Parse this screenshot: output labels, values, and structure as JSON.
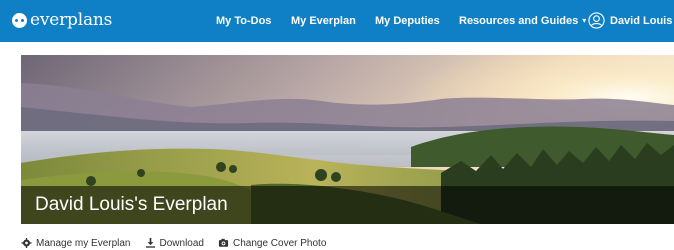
{
  "brand": {
    "name": "everplans",
    "icon": "everplans-logo-icon"
  },
  "nav": {
    "todos": "My To-Dos",
    "everplan": "My Everplan",
    "deputies": "My Deputies",
    "resources": "Resources and Guides",
    "user": "David Louis",
    "dropdown_glyph": "▾"
  },
  "hero": {
    "title": "David Louis's Everplan",
    "image": "landscape-cover-photo"
  },
  "actions": {
    "manage": {
      "label": "Manage my Everplan",
      "icon": "gear-icon"
    },
    "download": {
      "label": "Download",
      "icon": "download-icon"
    },
    "cover": {
      "label": "Change Cover Photo",
      "icon": "camera-icon"
    }
  },
  "colors": {
    "nav_background": "#0f7fc6",
    "nav_text": "#ffffff",
    "title_overlay": "rgba(0,0,0,0.55)"
  }
}
